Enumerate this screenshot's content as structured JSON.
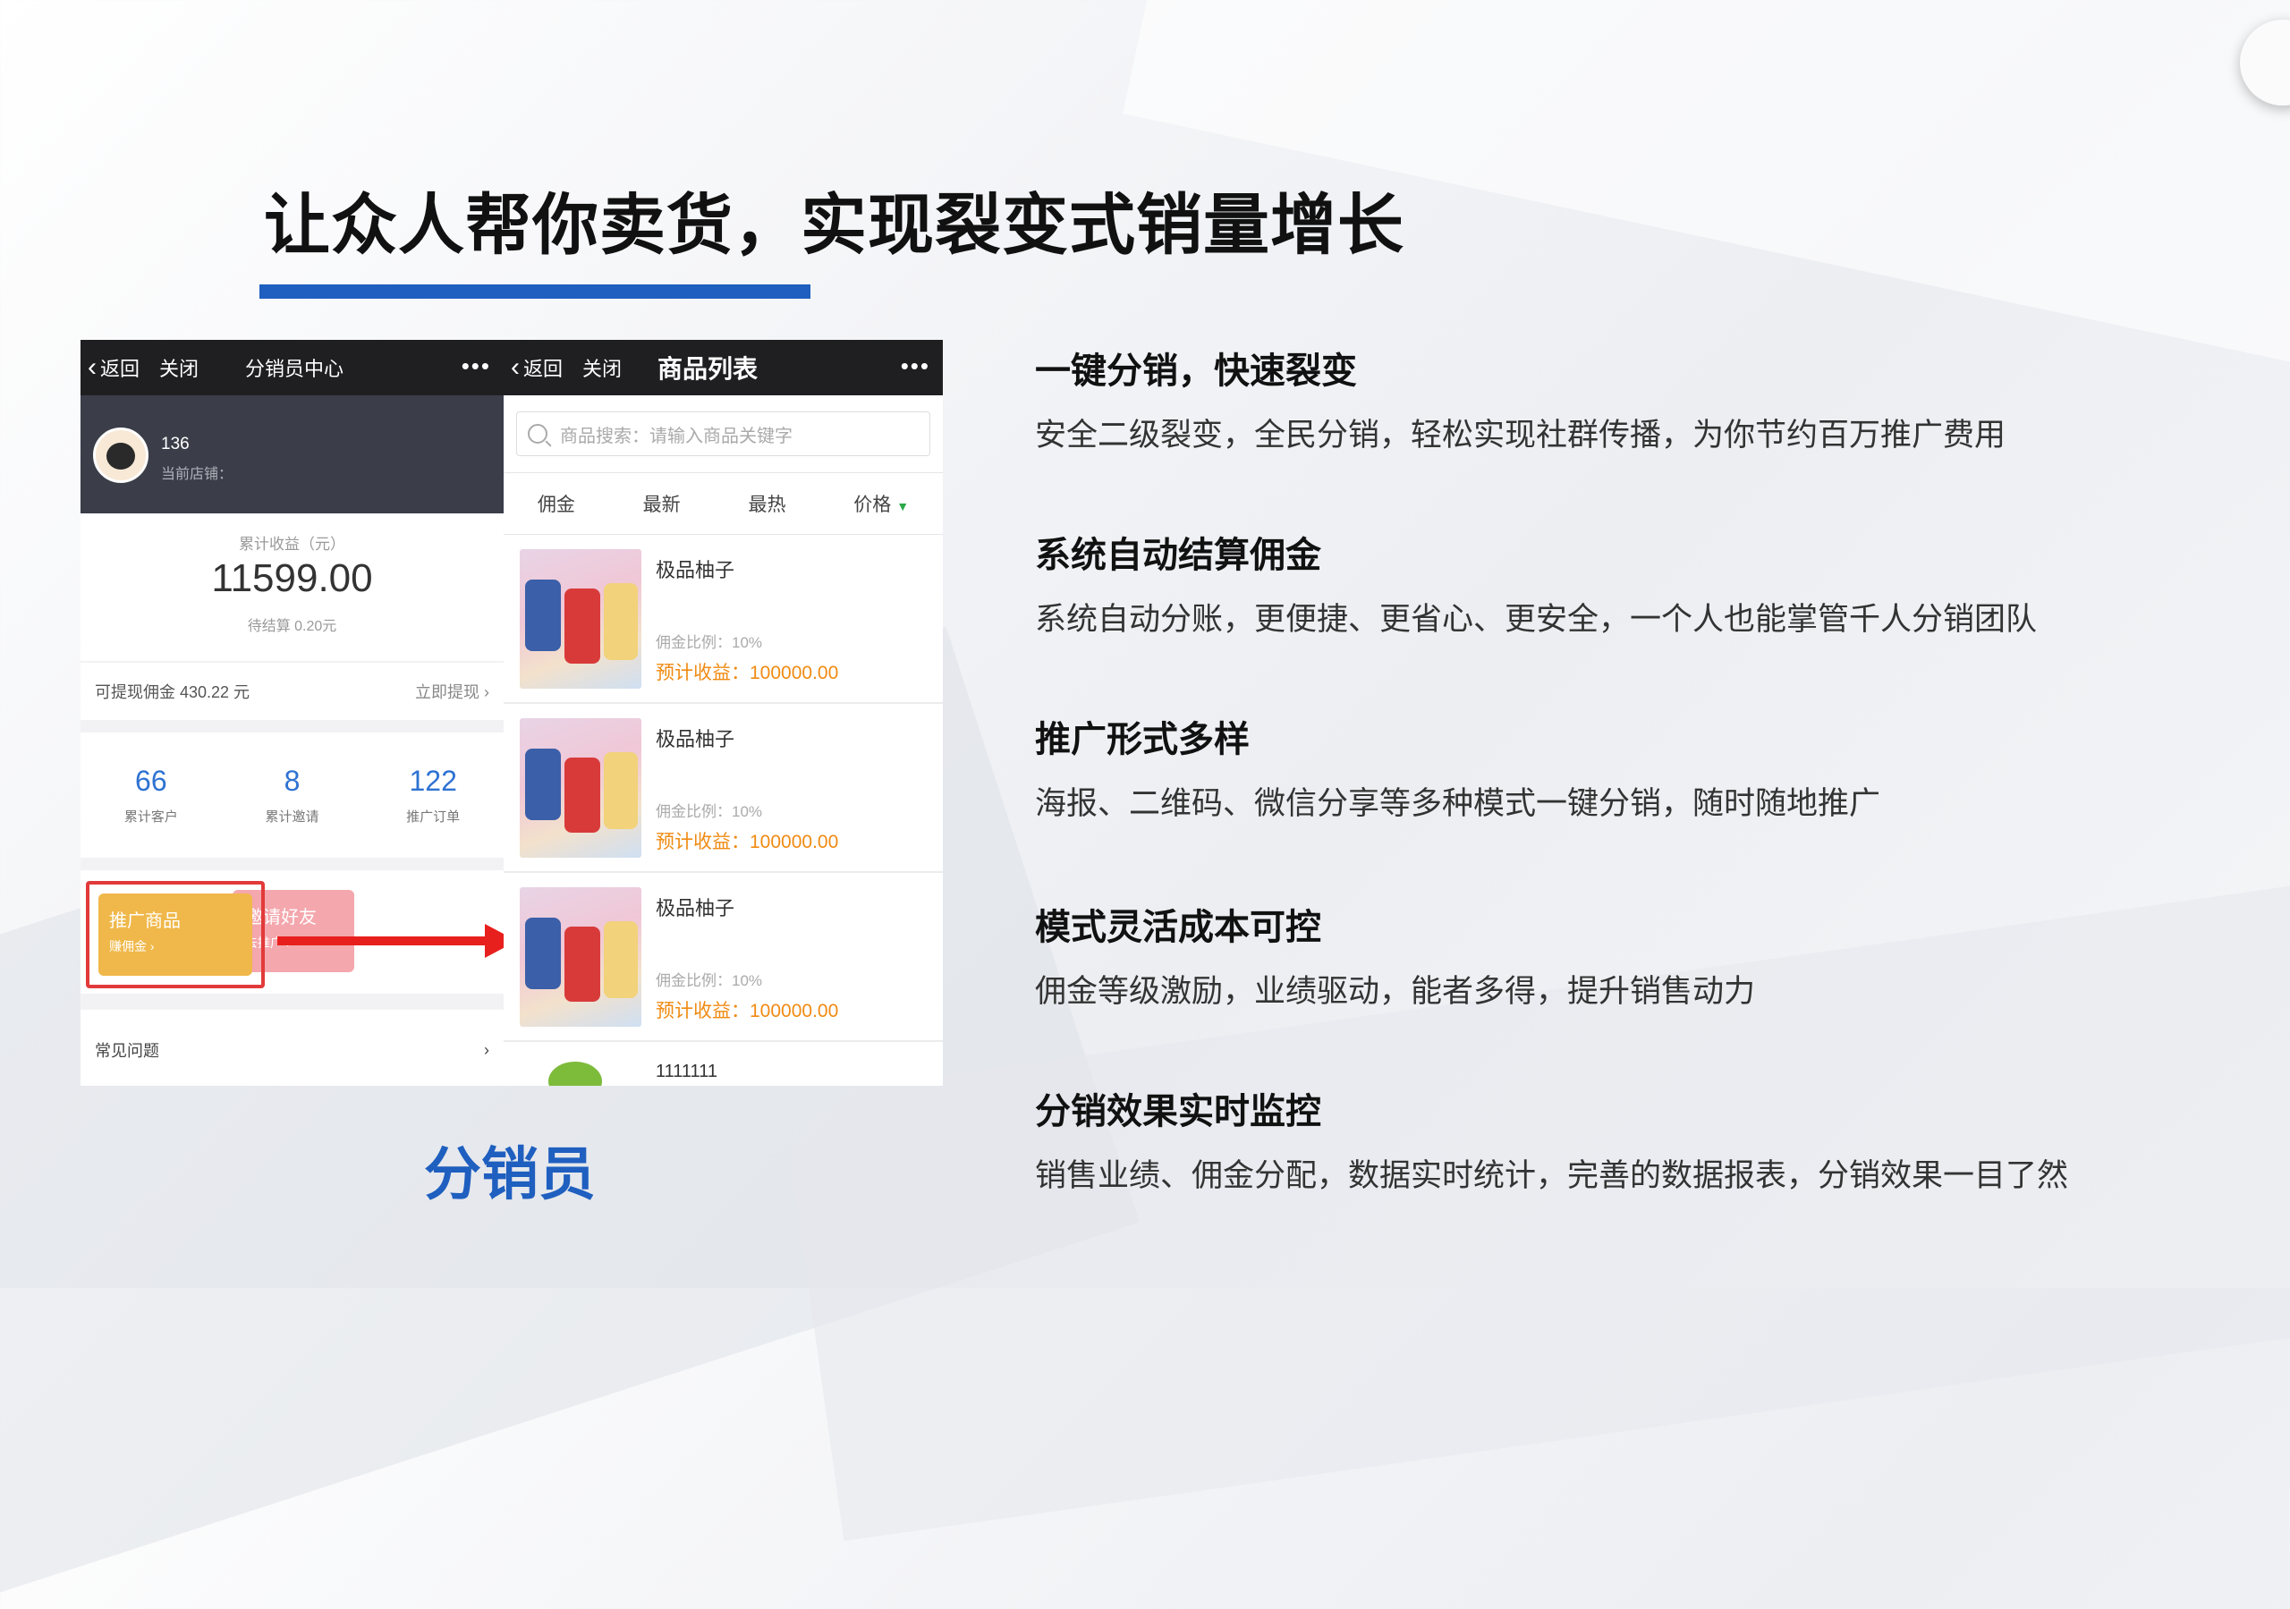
{
  "slide": {
    "title": "让众人帮你卖货，实现裂变式销量增长",
    "caption": "分销员"
  },
  "left_phone": {
    "back_label": "返回",
    "close_label": "关闭",
    "title": "分销员中心",
    "more_icon": "•••",
    "user_name": "136",
    "shop_label": "当前店铺：",
    "earnings_label": "累计收益（元）",
    "earnings_value": "11599.00",
    "pending_label": "待结算 0.20元",
    "withdrawable": "可提现佣金 430.22 元",
    "withdraw_action": "立即提现 ›",
    "stats": [
      {
        "value": "66",
        "label": "累计客户"
      },
      {
        "value": "8",
        "label": "累计邀请"
      },
      {
        "value": "122",
        "label": "推广订单"
      }
    ],
    "promo_button": {
      "label": "推广商品",
      "sub": "赚佣金 ›"
    },
    "invite_button": {
      "label": "邀请好友",
      "sub": "去推广 ›"
    },
    "faq_label": "常见问题",
    "faq_arrow": "›"
  },
  "right_phone": {
    "back_label": "返回",
    "close_label": "关闭",
    "title": "商品列表",
    "more_icon": "•••",
    "search_placeholder": "商品搜索：请输入商品关键字",
    "sorts": [
      "佣金",
      "最新",
      "最热",
      "价格"
    ],
    "items": [
      {
        "name": "极品柚子",
        "rate": "佣金比例：10%",
        "profit_label": "预计收益：",
        "profit_value": "100000.00"
      },
      {
        "name": "极品柚子",
        "rate": "佣金比例：10%",
        "profit_label": "预计收益：",
        "profit_value": "100000.00"
      },
      {
        "name": "极品柚子",
        "rate": "佣金比例：10%",
        "profit_label": "预计收益：",
        "profit_value": "100000.00"
      }
    ],
    "last_item_name": "1111111"
  },
  "features": [
    {
      "title": "一键分销，快速裂变",
      "desc": "安全二级裂变，全民分销，轻松实现社群传播，为你节约百万推广费用"
    },
    {
      "title": "系统自动结算佣金",
      "desc": "系统自动分账，更便捷、更省心、更安全，一个人也能掌管千人分销团队"
    },
    {
      "title": "推广形式多样",
      "desc": "海报、二维码、微信分享等多种模式一键分销，随时随地推广"
    },
    {
      "title": "模式灵活成本可控",
      "desc": "佣金等级激励，业绩驱动，能者多得，提升销售动力"
    },
    {
      "title": "分销效果实时监控",
      "desc": "销售业绩、佣金分配，数据实时统计，完善的数据报表，分销效果一目了然"
    }
  ],
  "colors": {
    "accent": "#1f5fbf",
    "highlight": "#e23a3a",
    "profit": "#f08a12",
    "stat": "#2e72d2"
  }
}
